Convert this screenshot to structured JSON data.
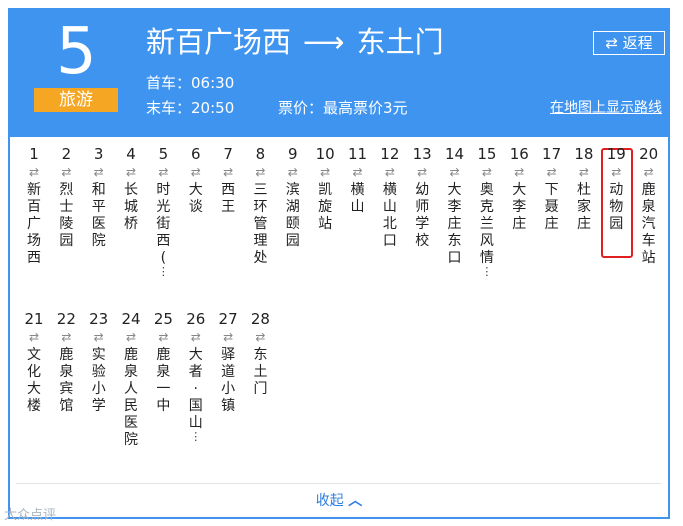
{
  "route": {
    "number": "5",
    "tag": "旅游",
    "from": "新百广场西",
    "to": "东土门",
    "arrow": "⟶",
    "first_label": "首车：",
    "first_time": "06:30",
    "last_label": "末车：",
    "last_time": "20:50",
    "fare": "票价：最高票价3元",
    "return_icon": "⇄",
    "return_label": "返程",
    "map_link": "在地图上显示路线"
  },
  "stops": [
    {
      "num": "1",
      "name": "新百广场西",
      "more": false,
      "selected": false
    },
    {
      "num": "2",
      "name": "烈士陵园",
      "more": false,
      "selected": false
    },
    {
      "num": "3",
      "name": "和平医院",
      "more": false,
      "selected": false
    },
    {
      "num": "4",
      "name": "长城桥",
      "more": false,
      "selected": false
    },
    {
      "num": "5",
      "name": "时光街西(",
      "more": true,
      "selected": false
    },
    {
      "num": "6",
      "name": "大谈",
      "more": false,
      "selected": false
    },
    {
      "num": "7",
      "name": "西王",
      "more": false,
      "selected": false
    },
    {
      "num": "8",
      "name": "三环管理处",
      "more": false,
      "selected": false
    },
    {
      "num": "9",
      "name": "滨湖颐园",
      "more": false,
      "selected": false
    },
    {
      "num": "10",
      "name": "凯旋站",
      "more": false,
      "selected": false
    },
    {
      "num": "11",
      "name": "横山",
      "more": false,
      "selected": false
    },
    {
      "num": "12",
      "name": "横山北口",
      "more": false,
      "selected": false
    },
    {
      "num": "13",
      "name": "幼师学校",
      "more": false,
      "selected": false
    },
    {
      "num": "14",
      "name": "大李庄东口",
      "more": false,
      "selected": false
    },
    {
      "num": "15",
      "name": "奥克兰风情",
      "more": true,
      "selected": false
    },
    {
      "num": "16",
      "name": "大李庄",
      "more": false,
      "selected": false
    },
    {
      "num": "17",
      "name": "下聂庄",
      "more": false,
      "selected": false
    },
    {
      "num": "18",
      "name": "杜家庄",
      "more": false,
      "selected": false
    },
    {
      "num": "19",
      "name": "动物园",
      "more": false,
      "selected": true
    },
    {
      "num": "20",
      "name": "鹿泉汽车站",
      "more": false,
      "selected": false
    },
    {
      "num": "21",
      "name": "文化大楼",
      "more": false,
      "selected": false
    },
    {
      "num": "22",
      "name": "鹿泉宾馆",
      "more": false,
      "selected": false
    },
    {
      "num": "23",
      "name": "实验小学",
      "more": false,
      "selected": false
    },
    {
      "num": "24",
      "name": "鹿泉人民医院",
      "more": false,
      "selected": false
    },
    {
      "num": "25",
      "name": "鹿泉一中",
      "more": false,
      "selected": false
    },
    {
      "num": "26",
      "name": "大者·国山",
      "more": true,
      "selected": false
    },
    {
      "num": "27",
      "name": "驿道小镇",
      "more": false,
      "selected": false
    },
    {
      "num": "28",
      "name": "东土门",
      "more": false,
      "selected": false
    }
  ],
  "dir_glyph": "⇄",
  "more_glyph": "⋮",
  "collapse_label": "收起",
  "collapse_icon": "︿",
  "watermark": "大众点评",
  "colors": {
    "header": "#3f94f0",
    "tag": "#f5a623",
    "highlight": "#e0201f",
    "link": "#2f7de1"
  }
}
